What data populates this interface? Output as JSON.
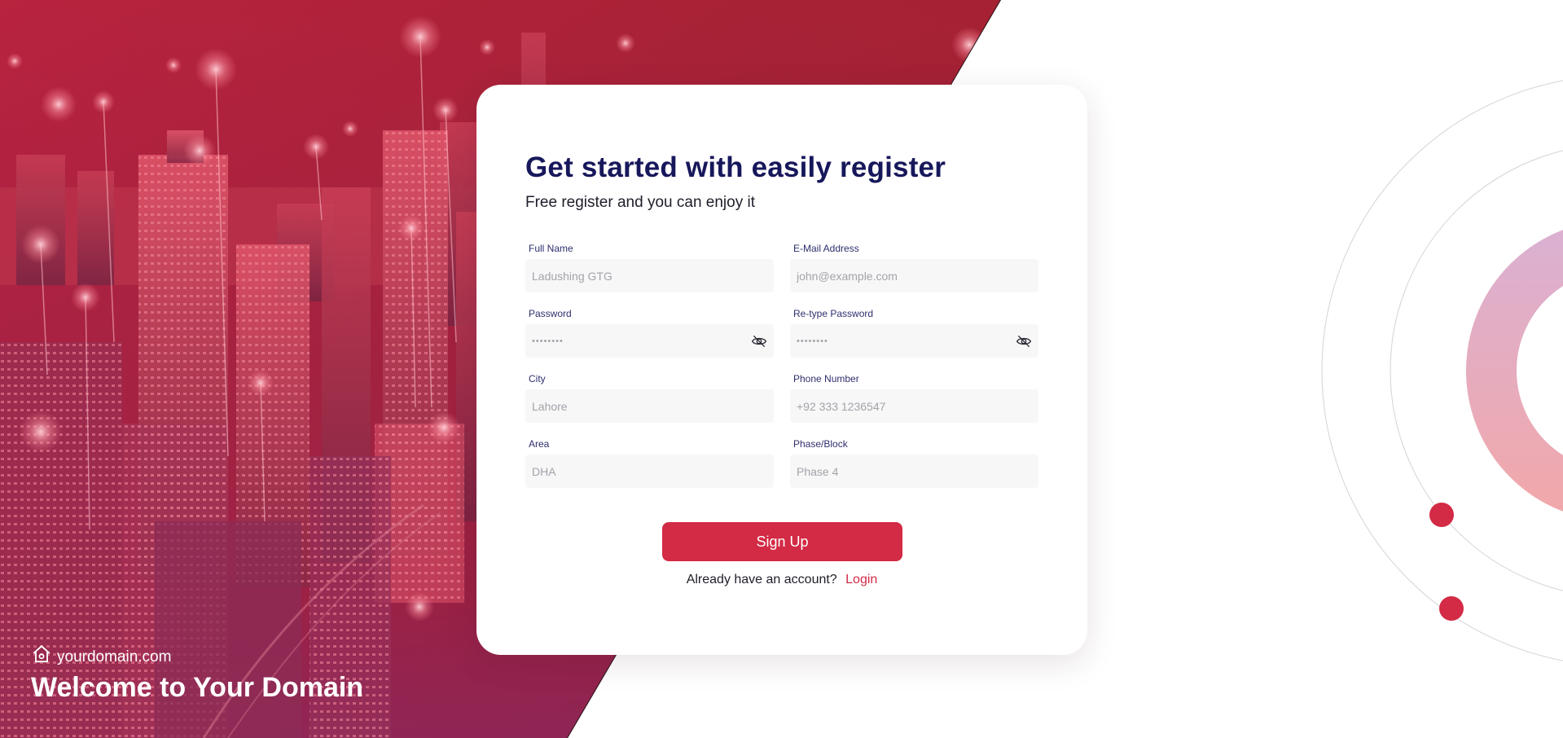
{
  "colors": {
    "accent": "#d32a45",
    "title": "#17185b",
    "hero_red": "#b8233e",
    "field_bg": "#f7f7f8"
  },
  "form": {
    "title": "Get started with easily register",
    "subtitle": "Free register and you can enjoy it",
    "fields": [
      {
        "label": "Full Name",
        "placeholder": "Ladushing GTG",
        "type": "text"
      },
      {
        "label": "E-Mail Address",
        "placeholder": "john@example.com",
        "type": "email"
      },
      {
        "label": "Password",
        "value": "••••••••",
        "type": "password",
        "icon": "eye-off-icon"
      },
      {
        "label": "Re-type Password",
        "value": "••••••••",
        "type": "password",
        "icon": "eye-off-icon"
      },
      {
        "label": "City",
        "placeholder": "Lahore",
        "type": "text"
      },
      {
        "label": "Phone Number",
        "placeholder": "+92 333 1236547",
        "type": "tel"
      },
      {
        "label": "Area",
        "placeholder": "DHA",
        "type": "text"
      },
      {
        "label": "Phase/Block",
        "placeholder": "Phase 4",
        "type": "text"
      }
    ],
    "signup_label": "Sign Up",
    "login_prompt": "Already have an account?",
    "login_label": "Login"
  },
  "brand": {
    "icon": "home-icon",
    "domain": "yourdomain.com",
    "welcome": "Welcome to Your Domain"
  }
}
